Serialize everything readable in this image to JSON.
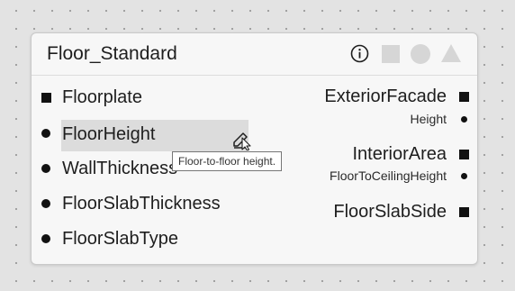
{
  "node": {
    "title": "Floor_Standard",
    "header_icons": [
      "info-icon",
      "square-shape-icon",
      "circle-shape-icon",
      "triangle-shape-icon"
    ],
    "inputs": [
      {
        "label": "Floorplate",
        "marker": "square"
      },
      {
        "label": "FloorHeight",
        "marker": "dot",
        "hovered": true
      },
      {
        "label": "WallThickness",
        "marker": "dot"
      },
      {
        "label": "FloorSlabThickness",
        "marker": "dot"
      },
      {
        "label": "FloorSlabType",
        "marker": "dot"
      }
    ],
    "outputs": [
      {
        "label": "ExteriorFacade",
        "marker": "square"
      },
      {
        "label": "Height",
        "marker": "small-dot"
      },
      {
        "label": "InteriorArea",
        "marker": "square"
      },
      {
        "label": "FloorToCeilingHeight",
        "marker": "small-dot"
      },
      {
        "label": "FloorSlabSide",
        "marker": "square"
      }
    ]
  },
  "tooltip": {
    "text": "Floor-to-floor height."
  },
  "colors": {
    "canvas": "#e3e3e3",
    "node_background": "#f7f7f7",
    "hover_highlight": "#dcdcdc",
    "port_marker": "#111111",
    "disabled_shape": "#d6d6d6"
  }
}
